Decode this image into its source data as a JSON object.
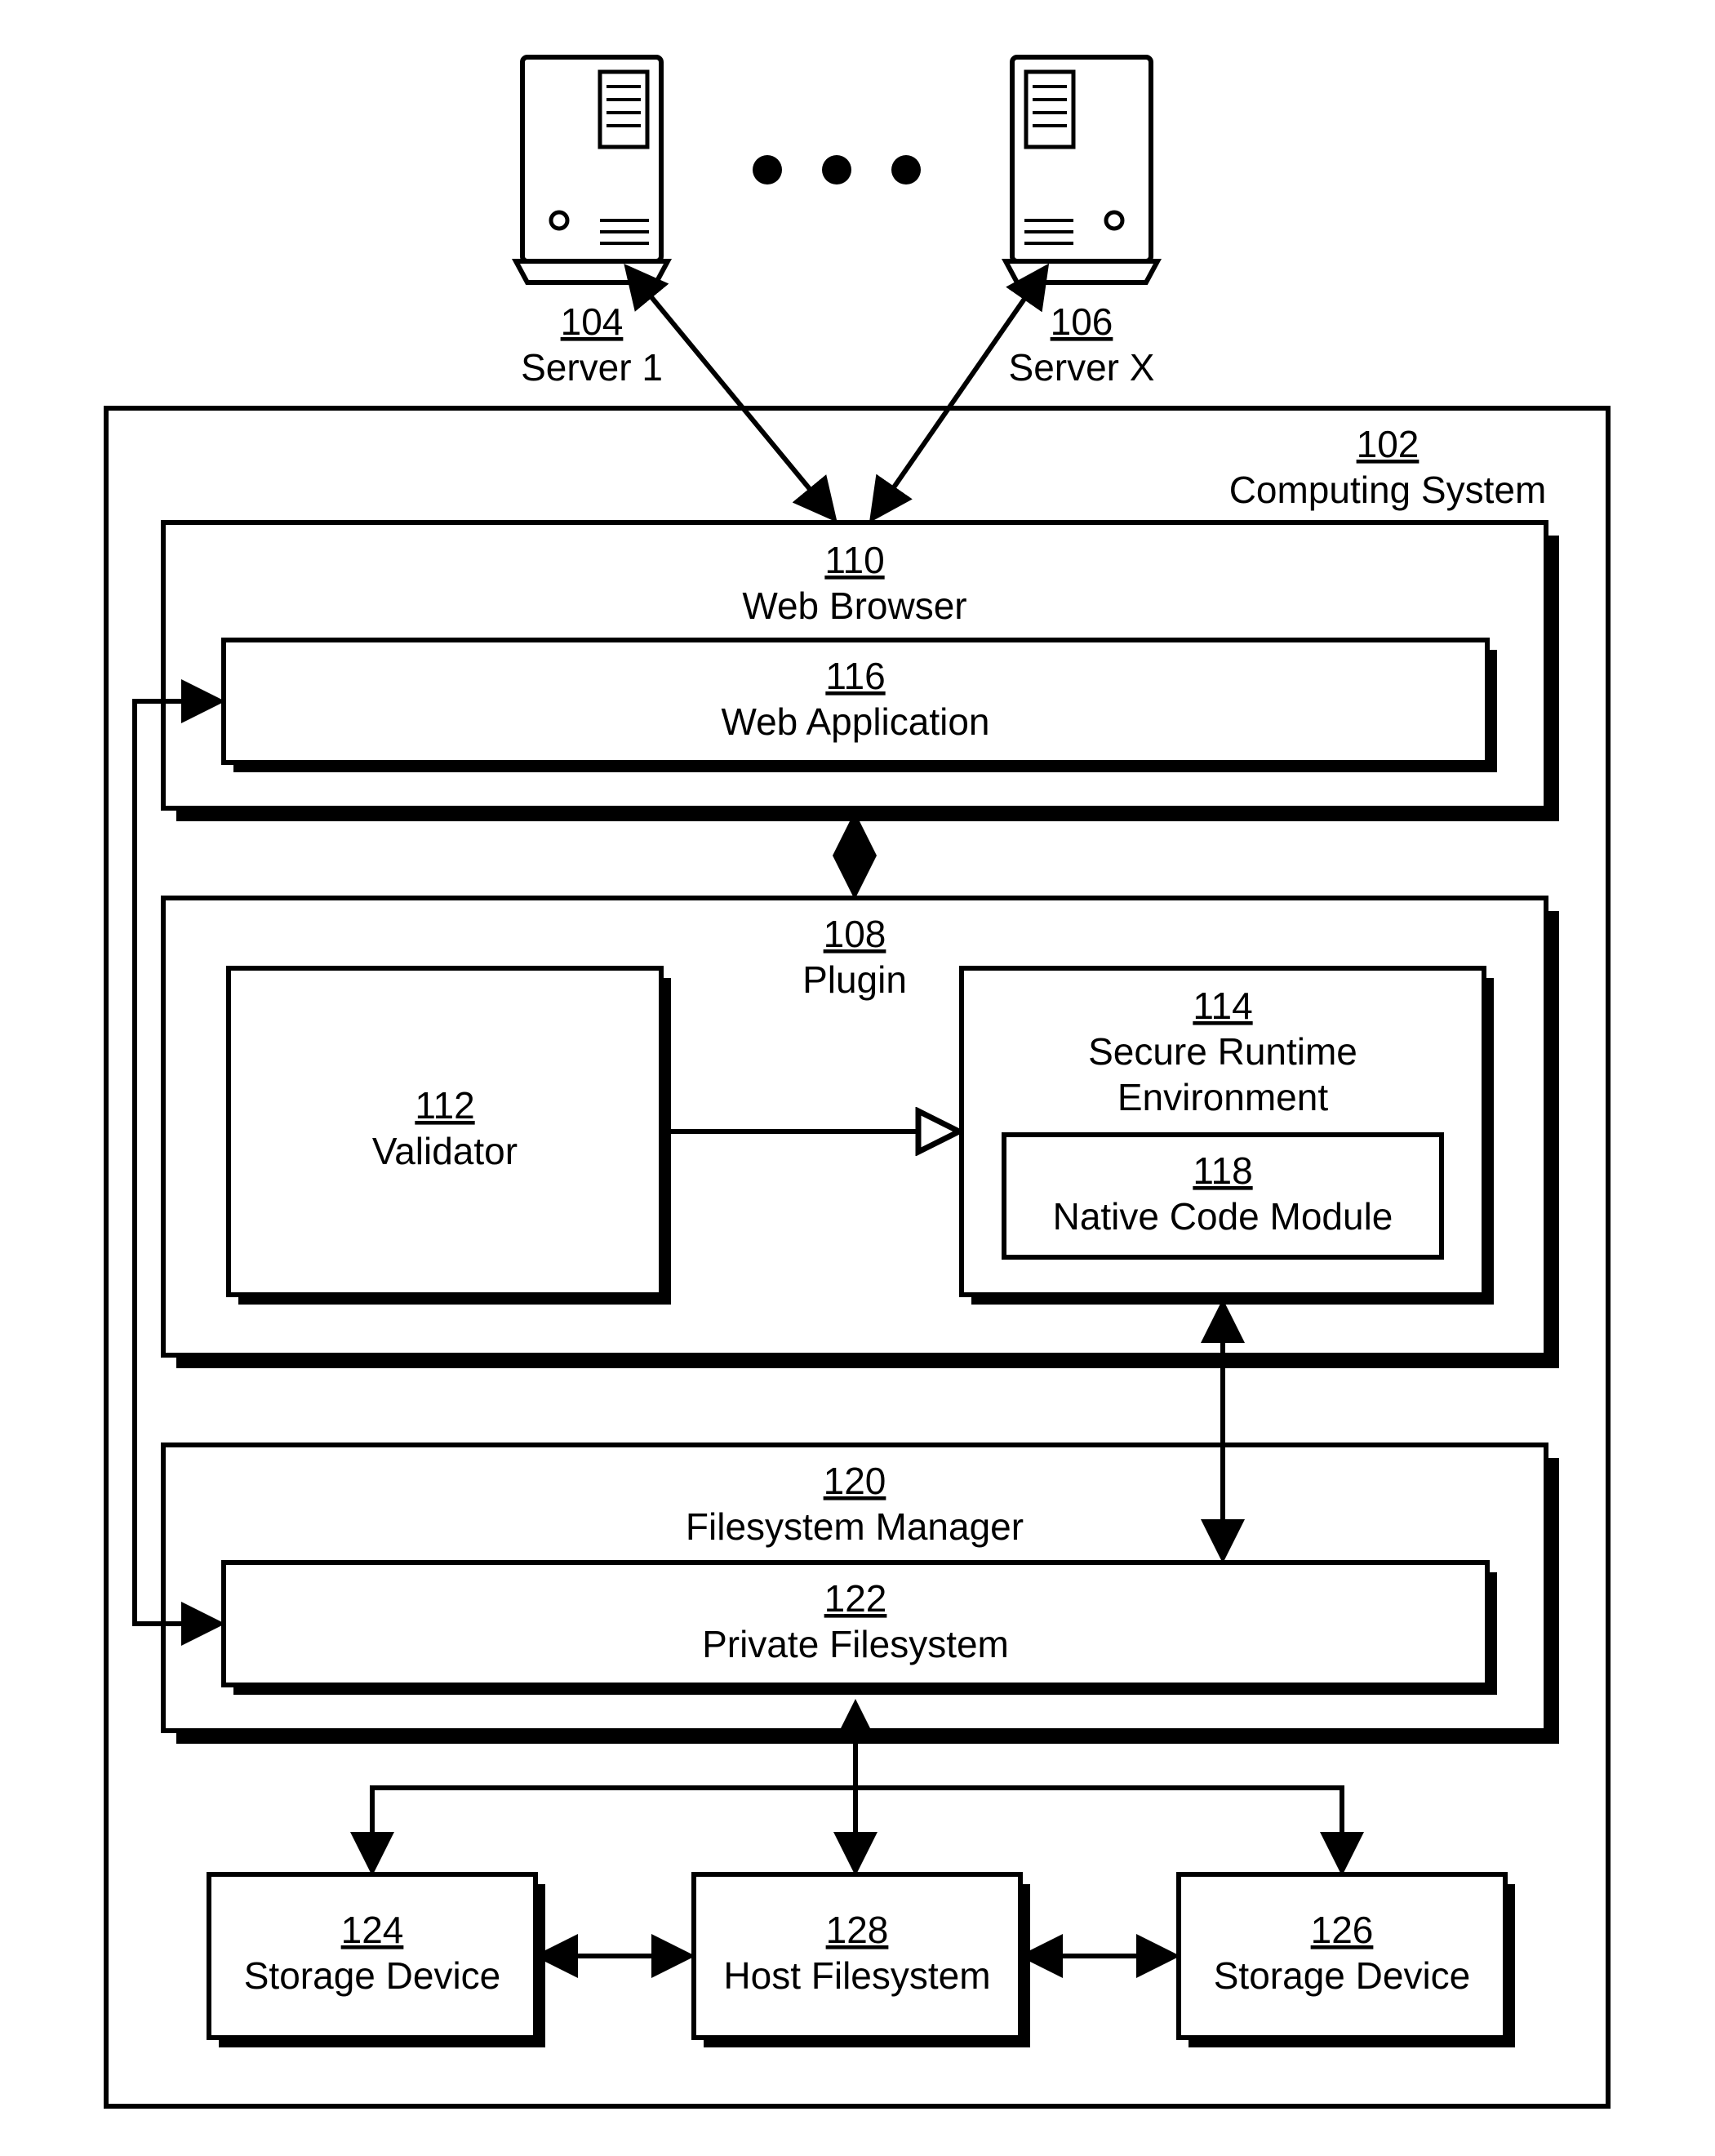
{
  "servers": {
    "left": {
      "num": "104",
      "label": "Server 1"
    },
    "right": {
      "num": "106",
      "label": "Server X"
    }
  },
  "computing_system": {
    "num": "102",
    "label": "Computing System"
  },
  "web_browser": {
    "num": "110",
    "label": "Web Browser"
  },
  "web_application": {
    "num": "116",
    "label": "Web Application"
  },
  "plugin": {
    "num": "108",
    "label": "Plugin"
  },
  "validator": {
    "num": "112",
    "label": "Validator"
  },
  "secure_runtime": {
    "num": "114",
    "label1": "Secure Runtime",
    "label2": "Environment"
  },
  "native_code": {
    "num": "118",
    "label": "Native Code Module"
  },
  "filesystem_mgr": {
    "num": "120",
    "label": "Filesystem Manager"
  },
  "private_fs": {
    "num": "122",
    "label": "Private Filesystem"
  },
  "storage_left": {
    "num": "124",
    "label": "Storage Device"
  },
  "host_fs": {
    "num": "128",
    "label": "Host Filesystem"
  },
  "storage_right": {
    "num": "126",
    "label": "Storage Device"
  }
}
